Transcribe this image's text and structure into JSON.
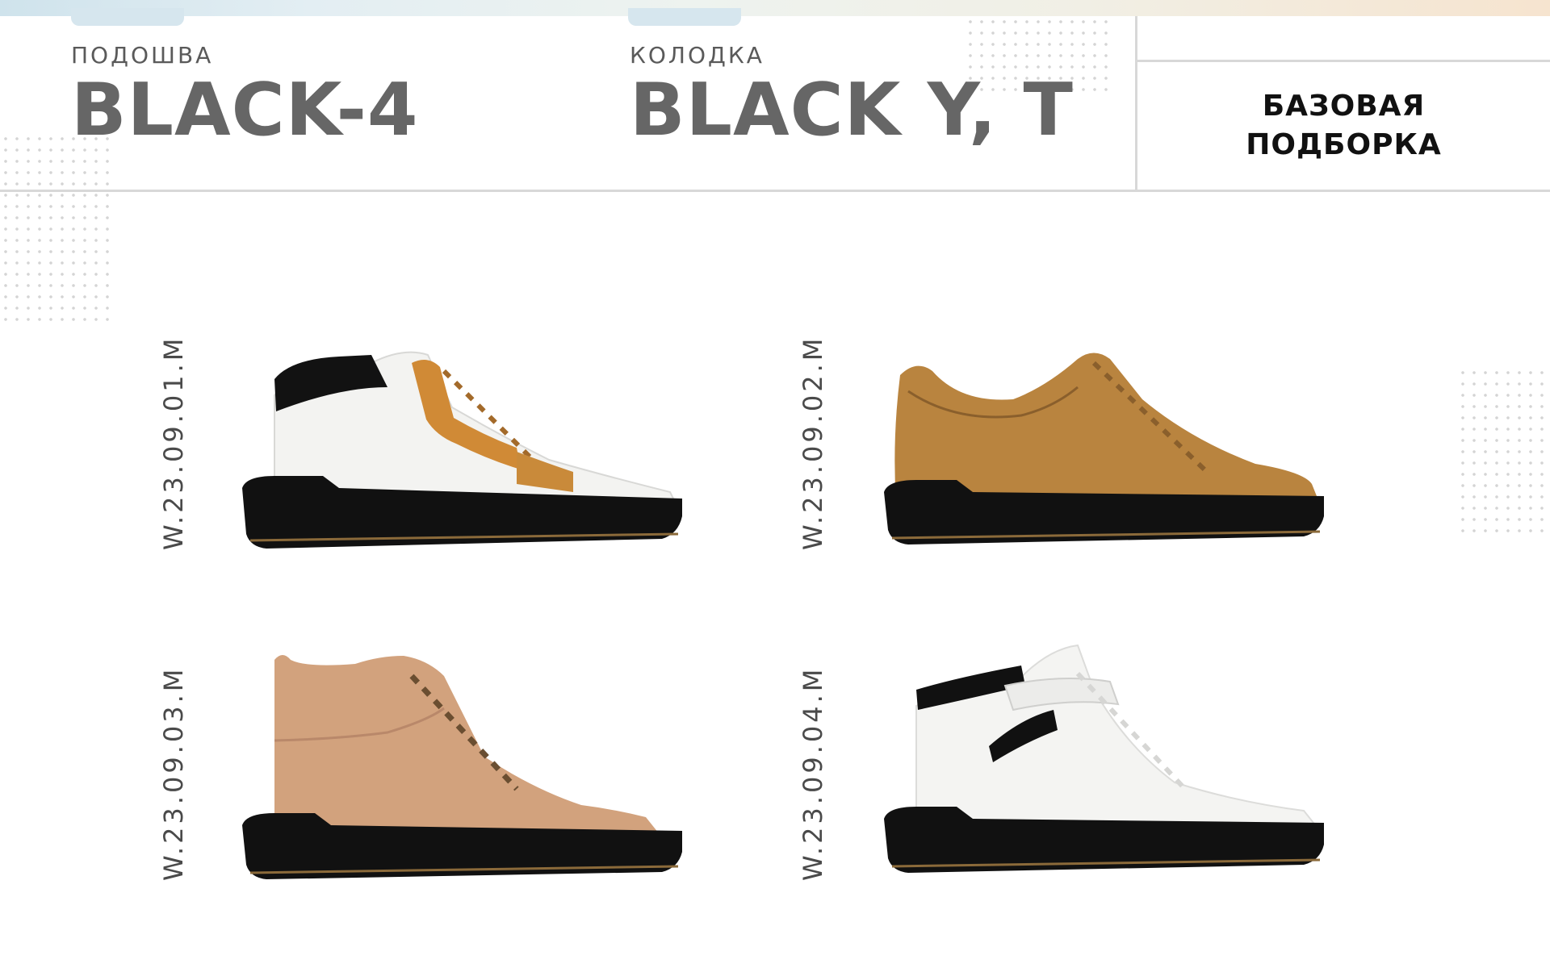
{
  "header": {
    "sole_label": "ПОДОШВА",
    "sole_value": "BLACK-4",
    "last_label": "КОЛОДКА",
    "last_value": "BLACK Y, T",
    "collection_line1": "БАЗОВАЯ",
    "collection_line2": "ПОДБОРКА"
  },
  "products": [
    {
      "sku": "W.23.09.01.M",
      "upper": "white leather with tan and black trim"
    },
    {
      "sku": "W.23.09.02.M",
      "upper": "tan leather"
    },
    {
      "sku": "W.23.09.03.M",
      "upper": "beige suede"
    },
    {
      "sku": "W.23.09.04.M",
      "upper": "white leather with strap"
    }
  ],
  "colors": {
    "sole": "#111111",
    "tan": "#c98a3a",
    "camel": "#b07f3f",
    "suede": "#d2a27d",
    "white_upper": "#f3f3f1"
  }
}
